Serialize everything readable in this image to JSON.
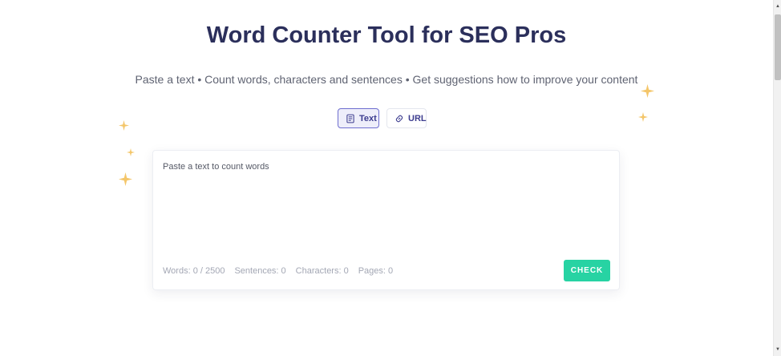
{
  "header": {
    "title": "Word Counter Tool for SEO Pros",
    "subtitle": "Paste a text • Count words, characters and sentences • Get suggestions how to improve your content"
  },
  "tabs": [
    {
      "label": "Text",
      "icon": "document-icon",
      "active": true
    },
    {
      "label": "URL",
      "icon": "link-icon",
      "active": false
    }
  ],
  "editor": {
    "placeholder": "Paste a text to count words",
    "value": ""
  },
  "stats": {
    "words": "Words: 0 / 2500",
    "sentences": "Sentences: 0",
    "characters": "Characters: 0",
    "pages": "Pages: 0"
  },
  "actions": {
    "check_label": "CHECK"
  },
  "colors": {
    "title": "#2b2f5b",
    "accent": "#6e6ecf",
    "check_button": "#27d3a3",
    "sparkle": "#f4c66a"
  }
}
